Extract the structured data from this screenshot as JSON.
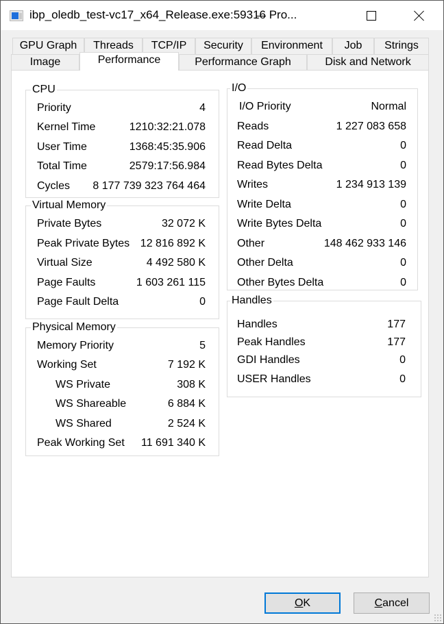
{
  "window": {
    "title": "ibp_oledb_test-vc17_x64_Release.exe:59316 Pro...",
    "icon": "app-window-icon",
    "controls": {
      "minimize": "minimize-icon",
      "maximize": "maximize-icon",
      "close": "close-icon"
    }
  },
  "tabs": {
    "row1": [
      {
        "label": "GPU Graph"
      },
      {
        "label": "Threads"
      },
      {
        "label": "TCP/IP"
      },
      {
        "label": "Security"
      },
      {
        "label": "Environment"
      },
      {
        "label": "Job"
      },
      {
        "label": "Strings"
      }
    ],
    "row2": [
      {
        "label": "Image"
      },
      {
        "label": "Performance",
        "active": true
      },
      {
        "label": "Performance Graph"
      },
      {
        "label": "Disk and Network"
      }
    ]
  },
  "cpu": {
    "title": "CPU",
    "rows": [
      {
        "label": "Priority",
        "value": "4"
      },
      {
        "label": "Kernel Time",
        "value": "1210:32:21.078"
      },
      {
        "label": "User Time",
        "value": "1368:45:35.906"
      },
      {
        "label": "Total Time",
        "value": "2579:17:56.984"
      },
      {
        "label": "Cycles",
        "value": "8 177 739 323 764 464"
      }
    ]
  },
  "virtual_memory": {
    "title": "Virtual Memory",
    "rows": [
      {
        "label": "Private Bytes",
        "value": "32 072 K"
      },
      {
        "label": "Peak Private Bytes",
        "value": "12 816 892 K"
      },
      {
        "label": "Virtual Size",
        "value": "4 492 580 K"
      },
      {
        "label": "Page Faults",
        "value": "1 603 261 115"
      },
      {
        "label": "Page Fault Delta",
        "value": "0"
      }
    ]
  },
  "physical_memory": {
    "title": "Physical Memory",
    "rows": [
      {
        "label": "Memory Priority",
        "value": "5"
      },
      {
        "label": "Working Set",
        "value": "7 192 K"
      },
      {
        "label": "WS Private",
        "value": "308 K",
        "indent": true
      },
      {
        "label": "WS Shareable",
        "value": "6 884 K",
        "indent": true
      },
      {
        "label": "WS Shared",
        "value": "2 524 K",
        "indent": true
      },
      {
        "label": "Peak Working Set",
        "value": "11 691 340 K"
      }
    ]
  },
  "io": {
    "title": "I/O",
    "rows": [
      {
        "label": "I/O Priority",
        "value": "Normal"
      },
      {
        "label": "Reads",
        "value": "1 227 083 658"
      },
      {
        "label": "Read Delta",
        "value": "0"
      },
      {
        "label": "Read Bytes Delta",
        "value": "0"
      },
      {
        "label": "Writes",
        "value": "1 234 913 139"
      },
      {
        "label": "Write Delta",
        "value": "0"
      },
      {
        "label": "Write Bytes Delta",
        "value": "0"
      },
      {
        "label": "Other",
        "value": "148 462 933 146"
      },
      {
        "label": "Other Delta",
        "value": "0"
      },
      {
        "label": "Other Bytes Delta",
        "value": "0"
      }
    ]
  },
  "handles": {
    "title": "Handles",
    "rows": [
      {
        "label": "Handles",
        "value": "177"
      },
      {
        "label": "Peak Handles",
        "value": "177"
      },
      {
        "label": "GDI Handles",
        "value": "0"
      },
      {
        "label": "USER Handles",
        "value": "0"
      }
    ]
  },
  "buttons": {
    "ok": {
      "label": "OK",
      "mnemonic": "O",
      "rest": "K"
    },
    "cancel": {
      "label": "Cancel",
      "mnemonic": "C",
      "rest": "ancel"
    }
  }
}
